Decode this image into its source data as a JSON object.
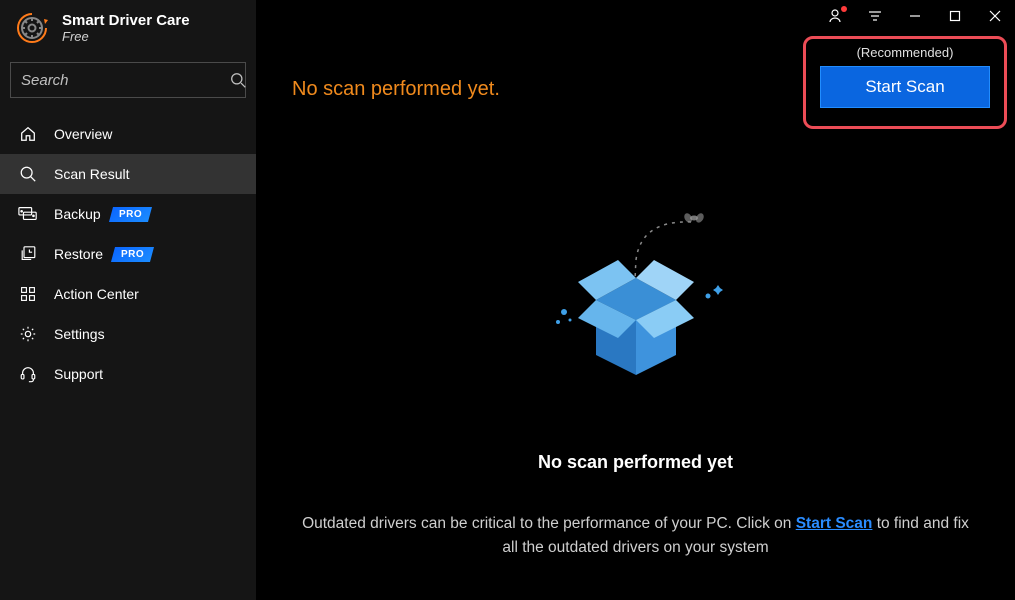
{
  "app": {
    "title": "Smart Driver Care",
    "subtitle": "Free"
  },
  "search": {
    "placeholder": "Search"
  },
  "sidebar": {
    "items": [
      {
        "label": "Overview",
        "icon": "home",
        "pro": false,
        "active": false
      },
      {
        "label": "Scan Result",
        "icon": "scan",
        "pro": false,
        "active": true
      },
      {
        "label": "Backup",
        "icon": "backup",
        "pro": true,
        "active": false
      },
      {
        "label": "Restore",
        "icon": "restore",
        "pro": true,
        "active": false
      },
      {
        "label": "Action Center",
        "icon": "grid",
        "pro": false,
        "active": false
      },
      {
        "label": "Settings",
        "icon": "gear",
        "pro": false,
        "active": false
      },
      {
        "label": "Support",
        "icon": "headset",
        "pro": false,
        "active": false
      }
    ]
  },
  "pro_badge": "PRO",
  "headline": "No scan performed yet.",
  "cta": {
    "recommended": "(Recommended)",
    "button": "Start Scan"
  },
  "hero": {
    "title": "No scan performed yet",
    "desc_pre": "Outdated drivers can be critical to the performance of your PC. Click on ",
    "desc_link": "Start Scan",
    "desc_post": " to find and fix all the outdated drivers on your system"
  },
  "colors": {
    "accent_orange": "#f08a1d",
    "accent_blue": "#0a66e0",
    "highlight_red": "#ec4c56",
    "link_blue": "#2a8cff"
  }
}
